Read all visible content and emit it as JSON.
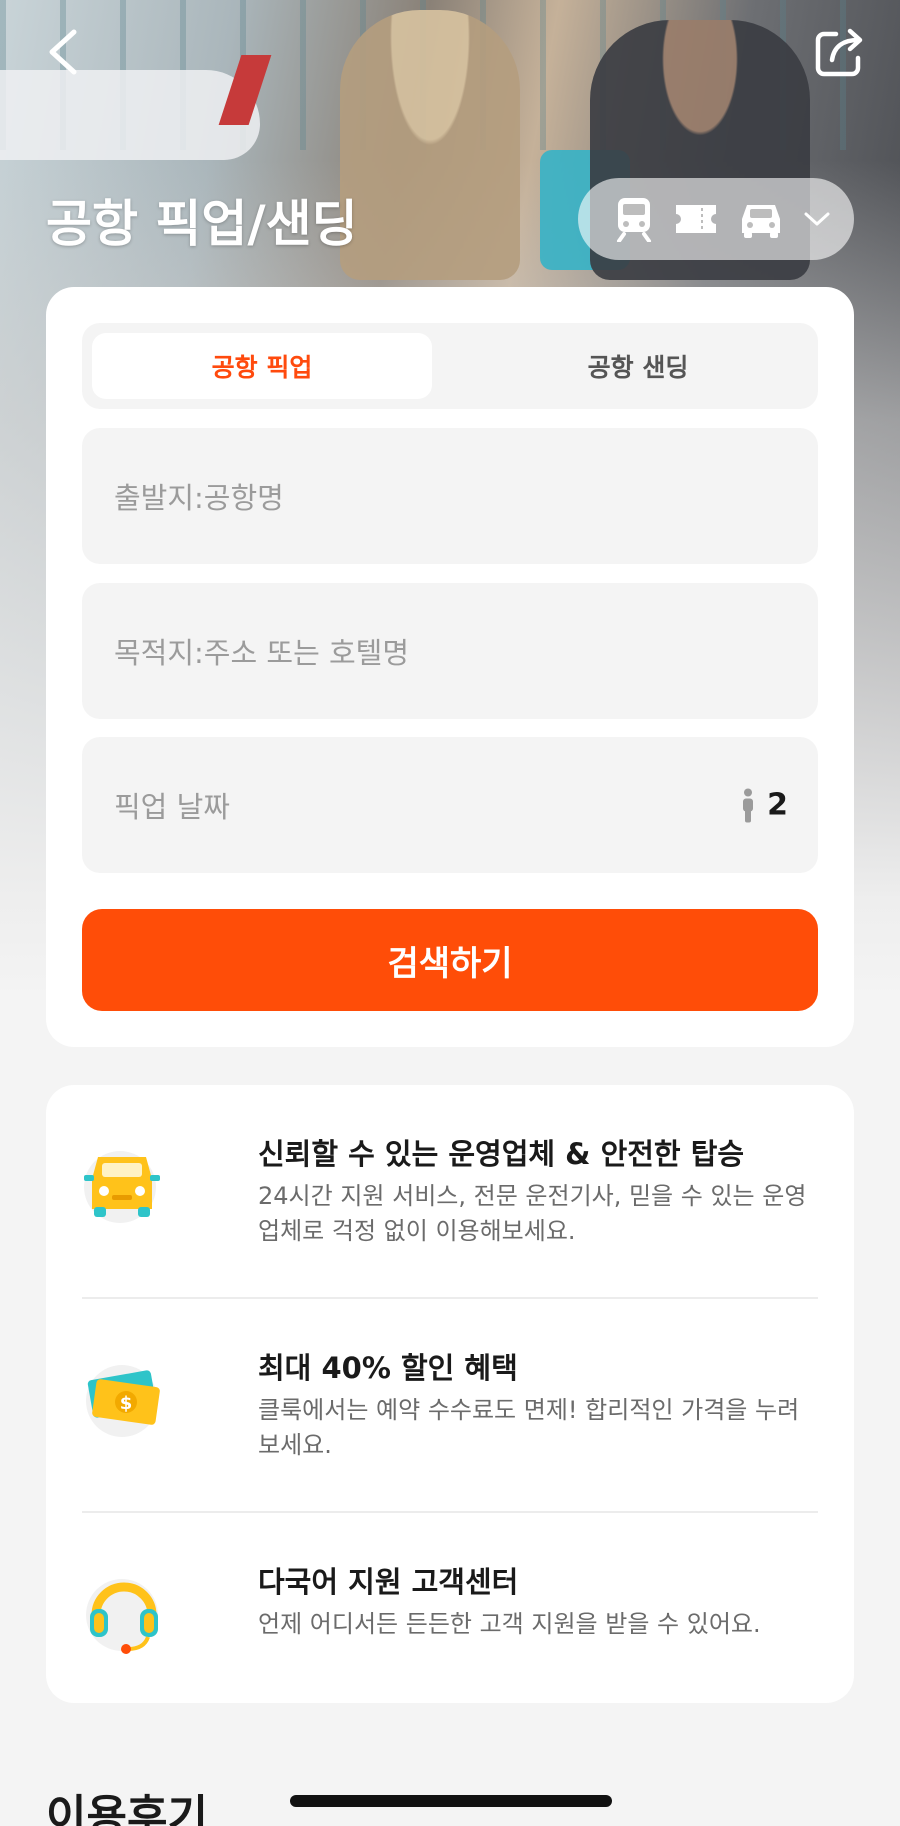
{
  "header": {
    "title": "공항 픽업/샌딩",
    "back_icon": "chevron-left-icon",
    "share_icon": "share-icon",
    "transport_icons": [
      "train-icon",
      "ticket-icon",
      "car-icon",
      "chevron-down-icon"
    ]
  },
  "tabs": [
    {
      "label": "공항 픽업",
      "active": true
    },
    {
      "label": "공항 샌딩",
      "active": false
    }
  ],
  "form": {
    "origin_placeholder": "출발지:공항명",
    "destination_placeholder": "목적지:주소 또는 호텔명",
    "date_placeholder": "픽업 날짜",
    "passenger_count": "2",
    "search_label": "검색하기"
  },
  "features": [
    {
      "icon": "car-icon",
      "title": "신뢰할 수 있는 운영업체 & 안전한 탑승",
      "desc": "24시간 지원 서비스, 전문 운전기사, 믿을 수 있는 운영업체로 걱정 없이 이용해보세요."
    },
    {
      "icon": "discount-money-icon",
      "title": "최대 40% 할인 혜택",
      "desc": "클룩에서는 예약 수수료도 면제! 합리적인 가격을 누려보세요."
    },
    {
      "icon": "headset-icon",
      "title": "다국어 지원 고객센터",
      "desc": "언제 어디서든 든든한 고객 지원을 받을 수 있어요."
    }
  ],
  "reviews": {
    "title": "이용후기"
  },
  "colors": {
    "accent": "#ff4d08",
    "active_tab_text": "#ff4a0d",
    "icon_yellow": "#ffc21a",
    "icon_teal": "#2ec4c9"
  }
}
